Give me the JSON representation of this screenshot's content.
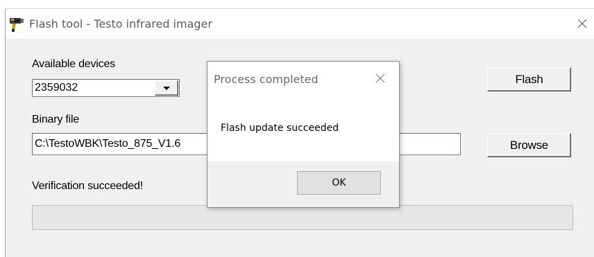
{
  "window": {
    "title": "Flash tool - Testo infrared imager"
  },
  "form": {
    "devices_label": "Available devices",
    "devices_selected": "2359032",
    "binary_label": "Binary file",
    "binary_path": "C:\\TestoWBK\\Testo_875_V1.6",
    "status_text": "Verification succeeded!",
    "progress": 0
  },
  "buttons": {
    "flash": "Flash",
    "browse": "Browse"
  },
  "dialog": {
    "title": "Process completed",
    "message": "Flash update succeeded",
    "ok": "OK"
  },
  "icons": {
    "app": "camera-flash-icon",
    "close": "close-icon",
    "dropdown": "dropdown-arrow-icon"
  }
}
